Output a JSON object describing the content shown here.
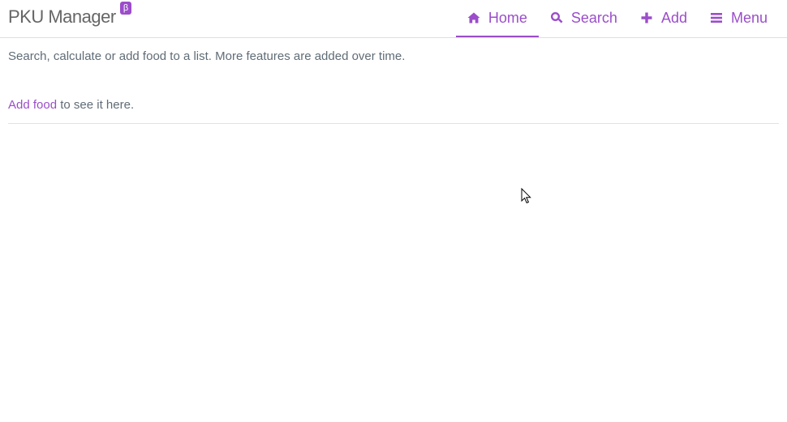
{
  "header": {
    "brand": "PKU Manager",
    "badge": "β",
    "nav": {
      "home": "Home",
      "search": "Search",
      "add": "Add",
      "menu": "Menu"
    }
  },
  "main": {
    "intro": "Search, calculate or add food to a list. More features are added over time.",
    "empty_link": "Add food",
    "empty_rest": " to see it here."
  },
  "colors": {
    "accent": "#9b4dca",
    "text": "#606c76"
  },
  "icons": {
    "home": "home-icon",
    "search": "search-icon",
    "add": "plus-icon",
    "menu": "bars-icon"
  }
}
